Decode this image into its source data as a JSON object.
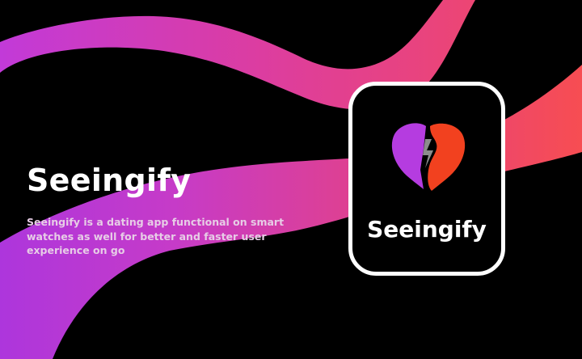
{
  "hero": {
    "title": "Seeingify",
    "description": "Seeingify is a dating app functional on smart watches as well for better and faster user experience on go"
  },
  "watch": {
    "app_name": "Seeingify",
    "logo_icon": "heart-logo-icon"
  },
  "colors": {
    "background": "#000000",
    "gradient_start": "#c23ad8",
    "gradient_end": "#f54a5c",
    "heart_left": "#b53ce0",
    "heart_right": "#f2411f",
    "frame": "#ffffff"
  }
}
